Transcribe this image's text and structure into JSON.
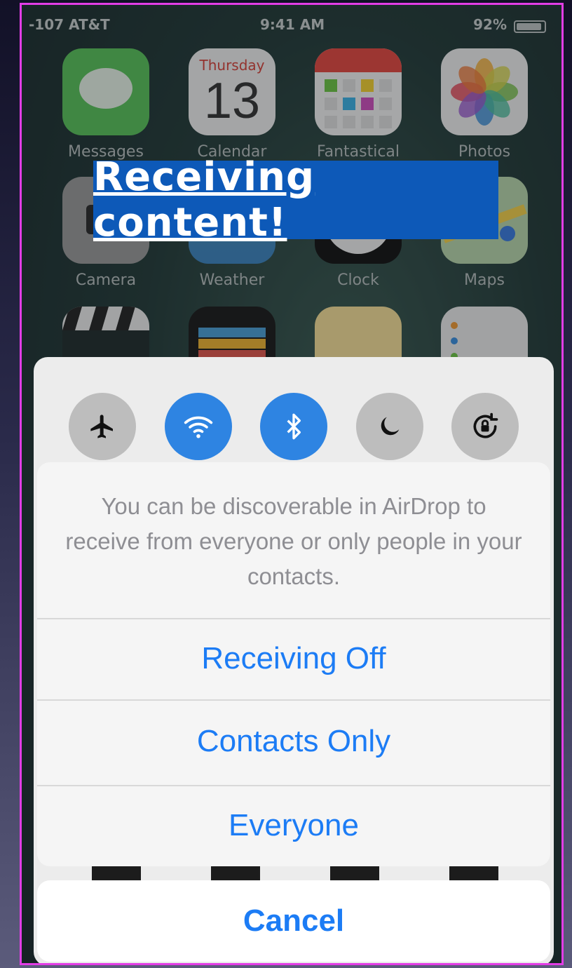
{
  "status_bar": {
    "carrier": "-107 AT&T",
    "time": "9:41 AM",
    "battery": "92%",
    "battery_level": 0.92
  },
  "apps": [
    {
      "label": "Messages"
    },
    {
      "label": "Calendar",
      "day": "Thursday",
      "date": "13"
    },
    {
      "label": "Fantastical"
    },
    {
      "label": "Photos"
    },
    {
      "label": "Camera"
    },
    {
      "label": "Weather"
    },
    {
      "label": "Clock"
    },
    {
      "label": "Maps"
    }
  ],
  "banner": {
    "text": "Receiving content!"
  },
  "control_center": {
    "toggles": [
      {
        "name": "airplane-mode",
        "icon": "airplane-icon",
        "state": "off"
      },
      {
        "name": "wifi",
        "icon": "wifi-icon",
        "state": "on"
      },
      {
        "name": "bluetooth",
        "icon": "bluetooth-icon",
        "state": "on"
      },
      {
        "name": "do-not-disturb",
        "icon": "moon-icon",
        "state": "off"
      },
      {
        "name": "rotation-lock",
        "icon": "rotation-lock-icon",
        "state": "off"
      }
    ]
  },
  "airdrop_sheet": {
    "message": "You can be discoverable in AirDrop to receive from everyone or only people in your contacts.",
    "options": [
      "Receiving Off",
      "Contacts Only",
      "Everyone"
    ],
    "cancel": "Cancel"
  },
  "colors": {
    "accent": "#1c7cf5",
    "toggle_on": "#2e84e2",
    "banner_bg": "#0d59b8",
    "frame_border": "#e23de6"
  }
}
